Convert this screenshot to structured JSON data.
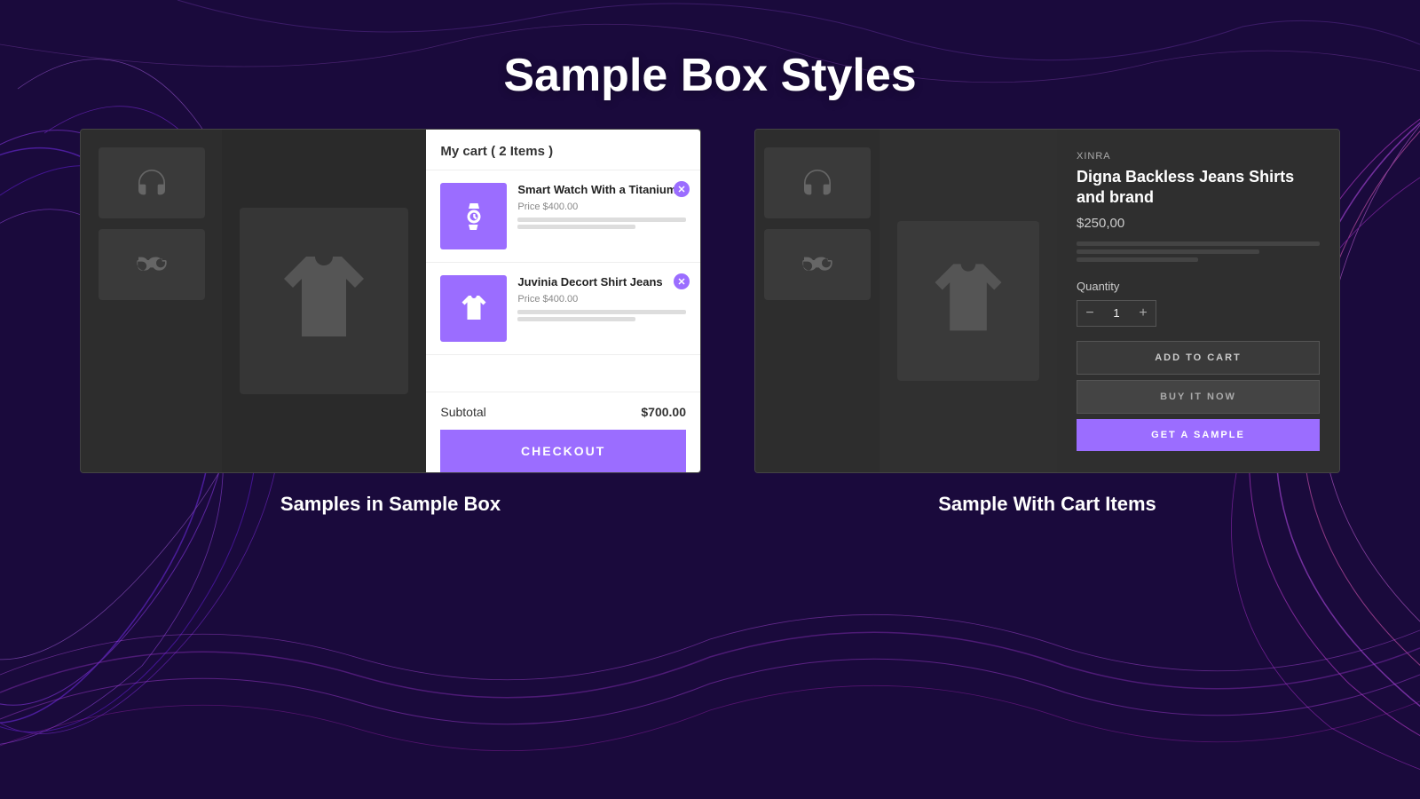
{
  "page": {
    "title": "Sample Box Styles",
    "bg_color": "#1a0a3c",
    "accent_color": "#9b6dff"
  },
  "left_box": {
    "cart": {
      "title": "My cart ( 2 Items )",
      "items": [
        {
          "name": "Smart Watch With a Titanium",
          "price_label": "Price",
          "price": "$400.00",
          "icon": "watch"
        },
        {
          "name": "Juvinia Decort Shirt Jeans",
          "price_label": "Price",
          "price": "$400.00",
          "icon": "shirt"
        }
      ],
      "subtotal_label": "Subtotal",
      "subtotal": "$700.00",
      "checkout_btn": "CHECKOUT"
    }
  },
  "right_box": {
    "product": {
      "brand": "XINRA",
      "name": "Digna Backless Jeans Shirts and brand",
      "price": "$250,00",
      "quantity_label": "Quantity",
      "quantity_value": "1",
      "add_to_cart_btn": "ADD TO CART",
      "buy_now_btn": "BUY IT NOW",
      "get_sample_btn": "GET A SAMPLE"
    }
  },
  "bottom_labels": {
    "left": "Samples in Sample Box",
    "right": "Sample With Cart Items"
  },
  "sidebar_icons": {
    "headphones": "🎧",
    "glasses": "👓"
  }
}
